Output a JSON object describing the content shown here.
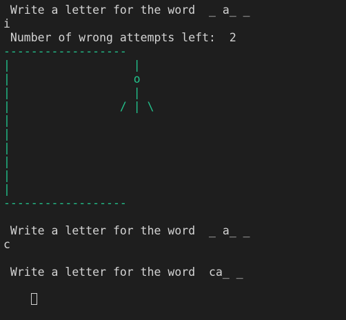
{
  "terminal": {
    "lines": [
      " Write a letter for the word  _ a_ _",
      "i",
      " Number of wrong attempts left:  2",
      "------------------",
      "|                  |",
      "|                  o",
      "|                  |",
      "|                / | \\",
      "|",
      "|",
      "|",
      "|",
      "|",
      "|",
      "------------------",
      "",
      " Write a letter for the word  _ a_ _",
      "c",
      "",
      " Write a letter for the word  ca_ _"
    ]
  },
  "colors": {
    "background": "#1e1e1e",
    "text": "#d4d4d4",
    "gallows": "#23c28c"
  }
}
